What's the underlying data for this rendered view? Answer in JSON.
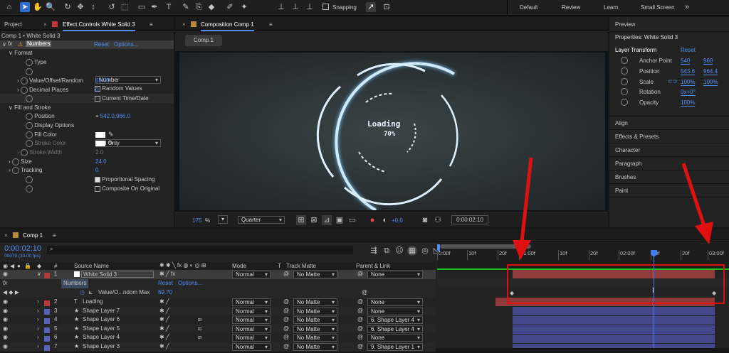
{
  "toolbar": {
    "snapping_label": "Snapping",
    "workspaces": [
      "Default",
      "Review",
      "Learn",
      "Small Screen"
    ]
  },
  "project_tab": "Project",
  "effect_controls": {
    "tab": "Effect Controls White Solid 3",
    "breadcrumb": "Comp 1 • White Solid 3",
    "effect_name": "Numbers",
    "reset": "Reset",
    "options": "Options...",
    "format_label": "Format",
    "type_label": "Type",
    "type_value": "Number",
    "random_values_label": "Random Values",
    "value_label": "Value/Offset/Random",
    "value": "69.70",
    "decimal_label": "Decimal Places",
    "decimal_value": "0",
    "current_time_label": "Current Time/Date",
    "fill_stroke_label": "Fill and Stroke",
    "position_label": "Position",
    "position_value": "542.0,966.0",
    "display_label": "Display Options",
    "display_value": "Fill Only",
    "fill_color_label": "Fill Color",
    "stroke_color_label": "Stroke Color",
    "stroke_width_label": "Stroke Width",
    "stroke_width_value": "2.0",
    "size_label": "Size",
    "size_value": "24.0",
    "tracking_label": "Tracking",
    "tracking_value": "0",
    "prop_spacing_label": "Proportional Spacing",
    "composite_label": "Composite On Original"
  },
  "composition": {
    "tab": "Composition Comp 1",
    "subtab": "Comp 1",
    "loading_text": "Loading",
    "percent_text": "70%",
    "zoom": "175",
    "zoom_unit": "%",
    "quality": "Quality",
    "quality_value": "Quarter",
    "exposure": "+0.0",
    "timecode": "0:00:02:10"
  },
  "right_panel": {
    "preview": "Preview",
    "properties_title": "Properties: White Solid 3",
    "layer_transform": "Layer Transform",
    "reset": "Reset",
    "anchor_label": "Anchor Point",
    "anchor": [
      "540",
      "960"
    ],
    "position_label": "Position",
    "position": [
      "543.6",
      "964.4"
    ],
    "scale_label": "Scale",
    "scale": [
      "100%",
      "100%"
    ],
    "rotation_label": "Rotation",
    "rotation": "0x+0°",
    "opacity_label": "Opacity",
    "opacity": "100%",
    "sections": [
      "Align",
      "Effects & Presets",
      "Character",
      "Paragraph",
      "Brushes",
      "Paint"
    ]
  },
  "timeline": {
    "tab": "Comp 1",
    "timecode": "0:00:02:10",
    "frames": "00070 (30.00 fps)",
    "headers": {
      "num": "#",
      "source": "Source Name",
      "mode": "Mode",
      "t": "T",
      "track": "Track Matte",
      "parent": "Parent & Link"
    },
    "ruler": [
      "0:00f",
      "10f",
      "20f",
      "01:00f",
      "10f",
      "20f",
      "02:00f",
      "10f",
      "20f",
      "03:00f"
    ],
    "layers": [
      {
        "num": "1",
        "name": "White Solid 3",
        "mode": "Normal",
        "matte": "No Matte",
        "parent": "None",
        "color": "#b33a3a",
        "type": "solid"
      },
      {
        "num": "2",
        "name": "Loading",
        "mode": "Normal",
        "matte": "No Matte",
        "parent": "None",
        "color": "#b33a3a",
        "type": "text"
      },
      {
        "num": "3",
        "name": "Shape Layer 7",
        "mode": "Normal",
        "matte": "No Matte",
        "parent": "None",
        "color": "#5863b8",
        "type": "shape"
      },
      {
        "num": "4",
        "name": "Shape Layer 6",
        "mode": "Normal",
        "matte": "No Matte",
        "parent": "6. Shape Layer 4",
        "color": "#5863b8",
        "type": "shape"
      },
      {
        "num": "5",
        "name": "Shape Layer 5",
        "mode": "Normal",
        "matte": "No Matte",
        "parent": "6. Shape Layer 4",
        "color": "#5863b8",
        "type": "shape"
      },
      {
        "num": "6",
        "name": "Shape Layer 4",
        "mode": "Normal",
        "matte": "No Matte",
        "parent": "None",
        "color": "#5863b8",
        "type": "shape"
      },
      {
        "num": "7",
        "name": "Shape Layer 3",
        "mode": "Normal",
        "matte": "No Matte",
        "parent": "9. Shape Layer 1",
        "color": "#5863b8",
        "type": "shape"
      }
    ],
    "effect_row": {
      "label": "Numbers",
      "reset": "Reset",
      "options": "Options..."
    },
    "prop_row": {
      "label": "Value/O...ndom Max",
      "value": "69.70"
    }
  },
  "colors": {
    "accent": "#4f8ef7",
    "red": "#e01010",
    "playhead": "#3f7ff0"
  }
}
